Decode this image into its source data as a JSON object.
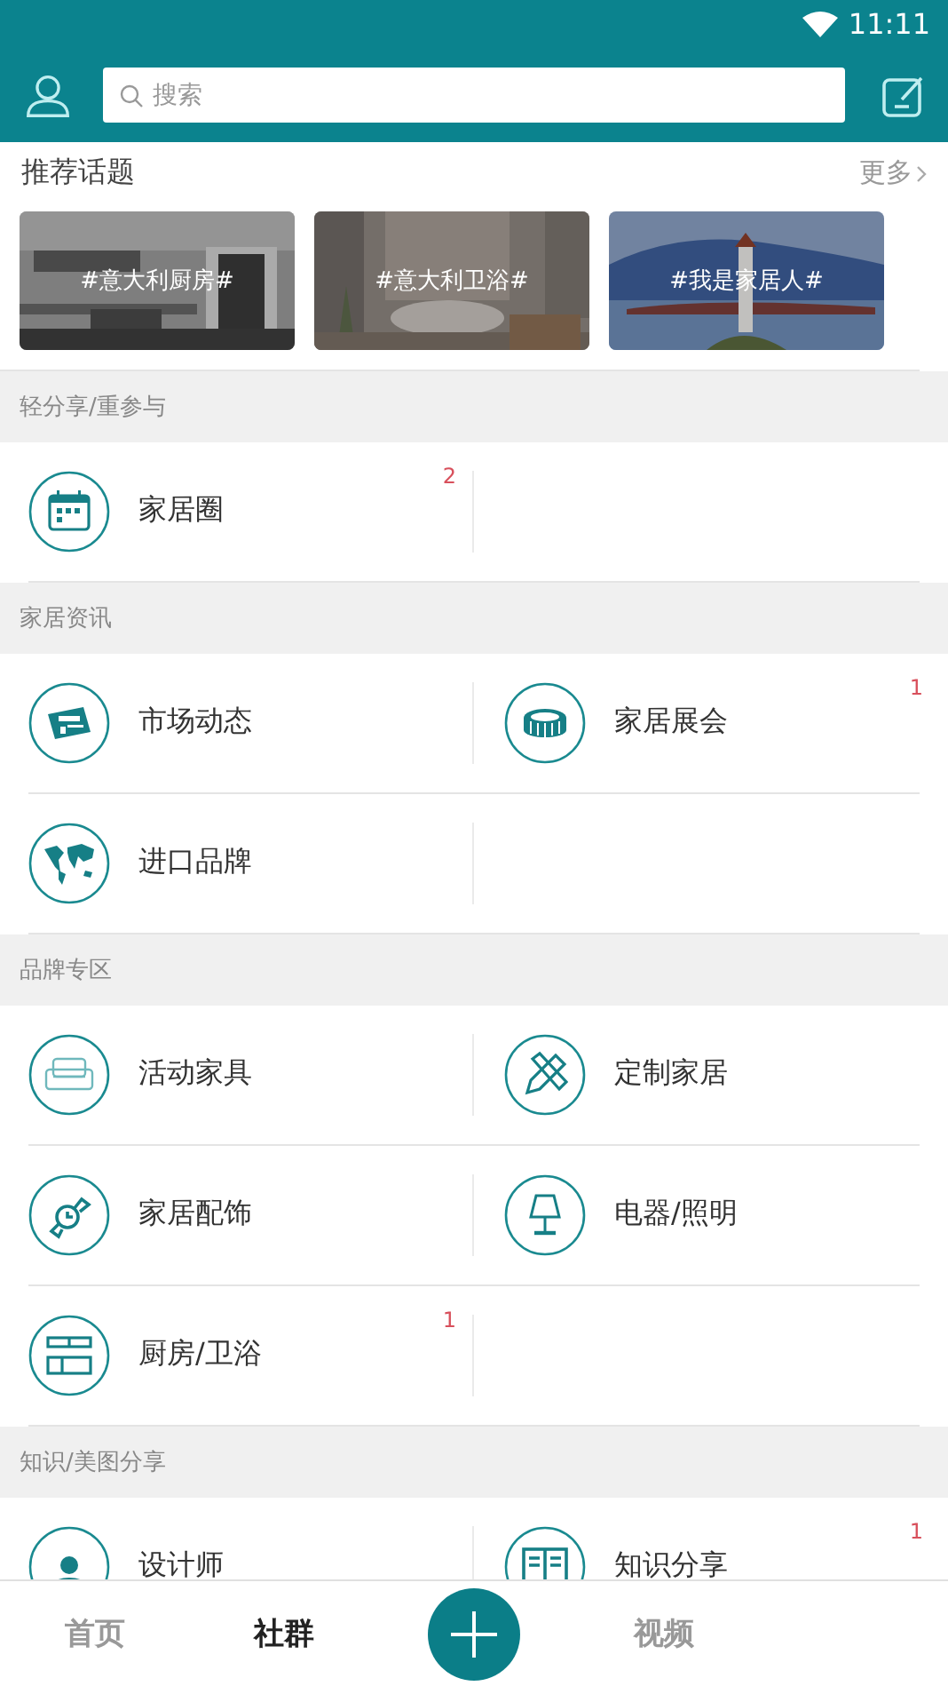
{
  "status_bar": {
    "time": "11:11"
  },
  "search": {
    "placeholder": "搜索"
  },
  "topics": {
    "title": "推荐话题",
    "more": "更多",
    "items": [
      {
        "label": "#意大利厨房#"
      },
      {
        "label": "#意大利卫浴#"
      },
      {
        "label": "#我是家居人#"
      }
    ]
  },
  "sections": [
    {
      "title": "轻分享/重参与",
      "items": [
        {
          "label": "家居圈",
          "badge": "2"
        }
      ]
    },
    {
      "title": "家居资讯",
      "items": [
        {
          "label": "市场动态"
        },
        {
          "label": "家居展会",
          "badge": "1"
        },
        {
          "label": "进口品牌"
        }
      ]
    },
    {
      "title": "品牌专区",
      "items": [
        {
          "label": "活动家具"
        },
        {
          "label": "定制家居"
        },
        {
          "label": "家居配饰"
        },
        {
          "label": "电器/照明"
        },
        {
          "label": "厨房/卫浴",
          "badge": "1"
        }
      ]
    },
    {
      "title": "知识/美图分享",
      "items": [
        {
          "label": "设计师"
        },
        {
          "label": "知识分享",
          "badge": "1"
        }
      ]
    }
  ],
  "bottom_nav": {
    "items": [
      {
        "label": "首页",
        "selected": false
      },
      {
        "label": "社群",
        "selected": true
      },
      {
        "label": "视频",
        "selected": false
      }
    ]
  }
}
